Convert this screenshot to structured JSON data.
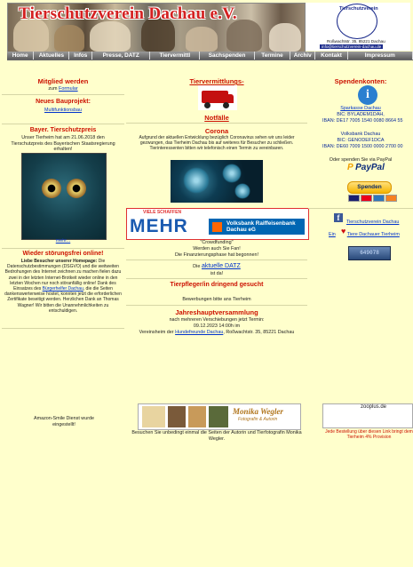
{
  "header": {
    "site_title": "Tierschutzverein Dachau e.V.",
    "logo_text": "Tierschutzverein",
    "logo_address": "Roßwachtstr. 35, 85221 Dachau",
    "logo_email": "info@tierschutzverein-dachau.de"
  },
  "nav": {
    "items": [
      "Home",
      "Aktuelles",
      "Infos",
      "Presse, DATZ",
      "Tiervermittl",
      "Sachspenden",
      "Termine",
      "Archiv",
      "Kontakt",
      "Impressum"
    ]
  },
  "left": {
    "member_title": "Mitglied werden",
    "member_text": "zum",
    "member_link": "Formular",
    "bau_title": "Neues Bauprojekt:",
    "bau_link": "Multifunktionsbau",
    "preis_title": "Bayer. Tierschutzpreis",
    "preis_text": "Unser Tierheim hat am 21.06.2018 den Tierschutzpreis des Bayerischen Staatsregierung erhalten!",
    "mehr_link": "mehr...",
    "stoerung_title": "Wieder störungsfrei online!",
    "stoerung_lead": "Liebe Besucher unserer Homepage:",
    "stoerung_text": "Die Datenschutzbestimmungen (DSGVO) und die weitweiten Bedrohungen des Internet zeichnen zu machen fielen dazu zwei in der letzten Internet-Brotkeit wieder online in den letzten Wochen nur noch störanfällig online! Dank des Einsatzes des",
    "stoerung_link": "Bürgerhelfer Dachau",
    "stoerung_text2": ", die die Seiten dankenswerterweise hostet, konnten jetzt die erforderlichen Zertifikate beseitigt werden. Herzlichen Dank an Thomas Wagner! Wir bitten die Unannehmlichkeiten zu entschuldigen.",
    "amazon_text": "Amazon-Smile Dienst wurde eingestellt!"
  },
  "center": {
    "tierverm_title": "Tiervermittlungs-",
    "notfaelle_link": "Notfälle",
    "corona_title": "Corona",
    "corona_text": "Aufgrund der aktuellen Entwicklung bezüglich Coronavirus sehen wir uns leider gezwungen, das Tierheim Dachau bis auf weiteres für Besucher zu schließen. Tierinteressenten bitten wir telefonisch einen Termin zu vereinbaren.",
    "mehr_top": "VIELE SCHAFFEN",
    "mehr_big": "MEHR",
    "bank_name": "Volksbank Raiffeisenbank Dachau eG",
    "crowd_title": "\"Crowdfunding\"",
    "crowd_text1": "Werden auch Sie Fan!",
    "crowd_text2": "Die Finanzierungsphase hat begonnen!",
    "datz_pre": "Die",
    "datz_link": "aktuelle DATZ",
    "datz_post": "ist da!",
    "tierpfleger_title": "Tierpfleger/in dringend gesucht",
    "tierpfleger_text": "Bewerbungen bitte ans Tierheim",
    "jhv_title": "Jahreshauptversammlung",
    "jhv_text1": "nach mehreren Verschiebungen jetzt Termin:",
    "jhv_text2": "09.12.2023 14:00h im",
    "jhv_text3a": "Vereinsheim der",
    "jhv_link": "Hundefreunde Dachau",
    "jhv_text3b": ", Roßwachtstr. 35, 85221 Dachau",
    "mw_name": "Monika Wegler",
    "mw_sub": "Fotografin & Autorin",
    "mw_text": "Besuchen Sie unbedingt einmal die Seiten der Autorin und Tierfotografin Monika Wegler."
  },
  "right": {
    "spenden_title": "Spendenkonten:",
    "bank1_link": "Sparkasse Dachau",
    "bank1_bic": "BIC: BYLADEM1DAH,",
    "bank1_iban": "IBAN: DE17 7005 1540 0080 8664 55",
    "bank2_name": "Volksbank Dachau",
    "bank2_bic": "BIC: GENODEF1DCA",
    "bank2_iban": "IBAN: DE60 7009 1500 0000 2700 00",
    "paypal_text": "Oder spenden Sie via PayPal",
    "paypal_logo": "PayPal",
    "spenden_button": "Spenden",
    "fb_link": "Tierschutzverein Dachau",
    "pin_pre": "Ein",
    "pin_link": "Tiere Dachauer Tierheim",
    "counter_value": "649078",
    "zoo_alt": "zooplus.de",
    "zoo_text": "Jede Bestellung über diesen Link bringt dem Tierheim 4% Provision"
  },
  "colors": {
    "background": "#ffffcc",
    "heading_red": "#cc1100",
    "link_blue": "#0033cc",
    "nav_gray": "#6a6a6a"
  }
}
